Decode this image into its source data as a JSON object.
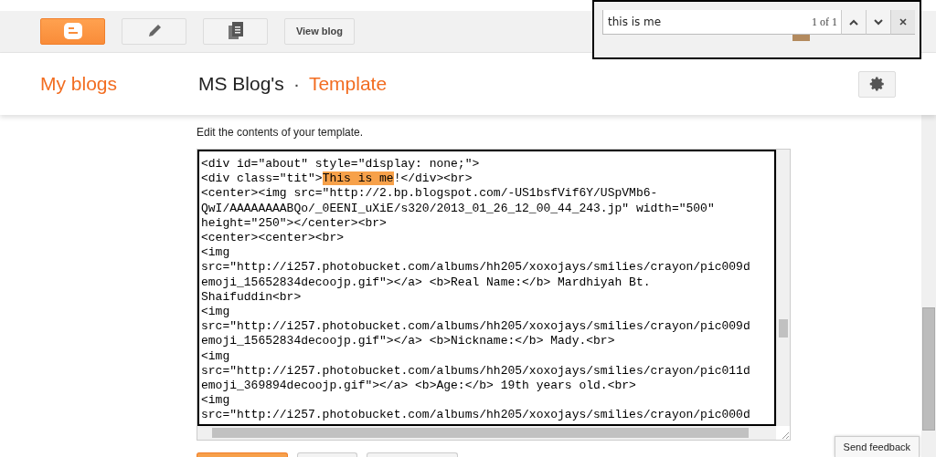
{
  "toolbar": {
    "buttons": [
      {
        "kind": "logo"
      },
      {
        "kind": "pencil"
      },
      {
        "kind": "pages"
      },
      {
        "kind": "text",
        "label": "View blog"
      }
    ]
  },
  "find_bar": {
    "value": "this is me",
    "count": "1 of 1"
  },
  "header": {
    "nav_link": "My blogs",
    "blog_name": "MS Blog's",
    "separator": "·",
    "section": "Template"
  },
  "editor": {
    "intro": "Edit the contents of your template.",
    "lines": [
      {
        "kind": "plain",
        "text": "<div id=\"about\" style=\"display: none;\">"
      },
      {
        "kind": "match",
        "before": "<div class=\"tit\">",
        "match": "This is me",
        "after": "!</div><br>"
      },
      {
        "kind": "plain",
        "text": "<center><img src=\"http://2.bp.blogspot.com/-US1bsfVif6Y/USpVMb6-"
      },
      {
        "kind": "plain",
        "text": "QwI/AAAAAAAABQo/_0EENI_uXiE/s320/2013_01_26_12_00_44_243.jp\" width=\"500\""
      },
      {
        "kind": "plain",
        "text": "height=\"250\"></center><br>"
      },
      {
        "kind": "plain",
        "text": "<center><center><br>"
      },
      {
        "kind": "plain",
        "text": "<img"
      },
      {
        "kind": "plain",
        "text": "src=\"http://i257.photobucket.com/albums/hh205/xoxojays/smilies/crayon/pic009d"
      },
      {
        "kind": "plain",
        "text": "emoji_15652834decoojp.gif\"></a> <b>Real Name:</b> Mardhiyah Bt."
      },
      {
        "kind": "plain",
        "text": "Shaifuddin<br>"
      },
      {
        "kind": "plain",
        "text": "<img"
      },
      {
        "kind": "plain",
        "text": "src=\"http://i257.photobucket.com/albums/hh205/xoxojays/smilies/crayon/pic009d"
      },
      {
        "kind": "plain",
        "text": "emoji_15652834decoojp.gif\"></a> <b>Nickname:</b> Mady.<br>"
      },
      {
        "kind": "plain",
        "text": "<img"
      },
      {
        "kind": "plain",
        "text": "src=\"http://i257.photobucket.com/albums/hh205/xoxojays/smilies/crayon/pic011d"
      },
      {
        "kind": "plain",
        "text": "emoji_369894decoojp.gif\"></a> <b>Age:</b> 19th years old.<br>"
      },
      {
        "kind": "plain",
        "text": "<img"
      },
      {
        "kind": "plain",
        "text": "src=\"http://i257.photobucket.com/albums/hh205/xoxojays/smilies/crayon/pic000d"
      }
    ]
  },
  "feedback": "Send feedback"
}
